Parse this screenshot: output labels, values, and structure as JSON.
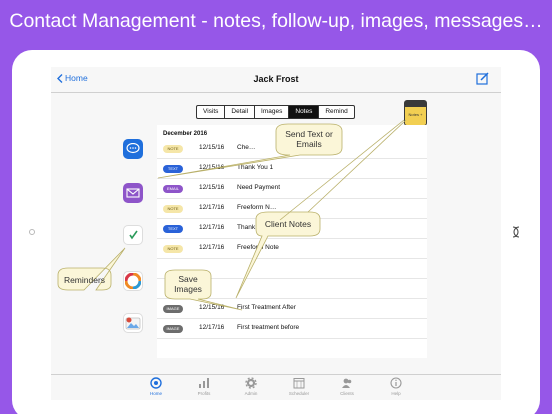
{
  "headline": "Contact Management - notes, follow-up, images, messages…",
  "navbar": {
    "back_label": "Home",
    "title": "Jack Frost"
  },
  "segments": [
    {
      "label": "Visits",
      "active": false
    },
    {
      "label": "Detail",
      "active": false
    },
    {
      "label": "Images",
      "active": false
    },
    {
      "label": "Notes",
      "active": true
    },
    {
      "label": "Remind",
      "active": false
    }
  ],
  "notes_pad_label": "Notes +",
  "list": {
    "section_header": "December 2016",
    "rows": [
      {
        "badge": "NOTE",
        "badge_color": "#f5e6a8",
        "badge_text_color": "#6a5a10",
        "date": "12/15/16",
        "text": "Che…"
      },
      {
        "badge": "TEXT",
        "badge_color": "#2a62d8",
        "badge_text_color": "#ffffff",
        "date": "12/15/16",
        "text": "Thank You 1"
      },
      {
        "badge": "EMAIL",
        "badge_color": "#8e55c9",
        "badge_text_color": "#ffffff",
        "date": "12/15/16",
        "text": "Need Payment"
      },
      {
        "badge": "NOTE",
        "badge_color": "#f5e6a8",
        "badge_text_color": "#6a5a10",
        "date": "12/17/16",
        "text": "Freeform N…"
      },
      {
        "badge": "TEXT",
        "badge_color": "#2a62d8",
        "badge_text_color": "#ffffff",
        "date": "12/17/16",
        "text": "Thank You"
      },
      {
        "badge": "NOTE",
        "badge_color": "#f5e6a8",
        "badge_text_color": "#6a5a10",
        "date": "12/17/16",
        "text": "Freeform Note"
      }
    ],
    "image_rows": [
      {
        "badge": "IMAGE",
        "badge_color": "#6d6d6d",
        "badge_text_color": "#ffffff",
        "date": "12/15/16",
        "text": "First Treatment After"
      },
      {
        "badge": "IMAGE",
        "badge_color": "#6d6d6d",
        "badge_text_color": "#ffffff",
        "date": "12/17/16",
        "text": "First treatment before"
      }
    ]
  },
  "sidebar_icons": [
    {
      "name": "message-bubble-icon",
      "color": "#1f6fdc"
    },
    {
      "name": "envelope-icon",
      "color": "#8e55c9"
    },
    {
      "name": "reminder-check-icon",
      "color": "#e85a7a"
    },
    {
      "name": "color-wheel-icon",
      "color": "#f08a24"
    },
    {
      "name": "photo-icon",
      "color": "#d84a3a"
    }
  ],
  "callouts": {
    "send_text": "Send Text or\nEmails",
    "client_notes": "Client Notes",
    "reminders": "Reminders",
    "save_images": "Save\nImages"
  },
  "tabs": [
    {
      "label": "Home",
      "icon": "home-target-icon",
      "active": true
    },
    {
      "label": "Profits",
      "icon": "bar-chart-icon",
      "active": false
    },
    {
      "label": "Admin",
      "icon": "gear-icon",
      "active": false
    },
    {
      "label": "Scheduler",
      "icon": "calendar-icon",
      "active": false
    },
    {
      "label": "Clients",
      "icon": "people-icon",
      "active": false
    },
    {
      "label": "Help",
      "icon": "info-icon",
      "active": false
    }
  ],
  "colors": {
    "background": "#9657e8",
    "accent": "#1f6fdc",
    "callout_fill": "#fbf6d8",
    "callout_stroke": "#b9b06a"
  }
}
